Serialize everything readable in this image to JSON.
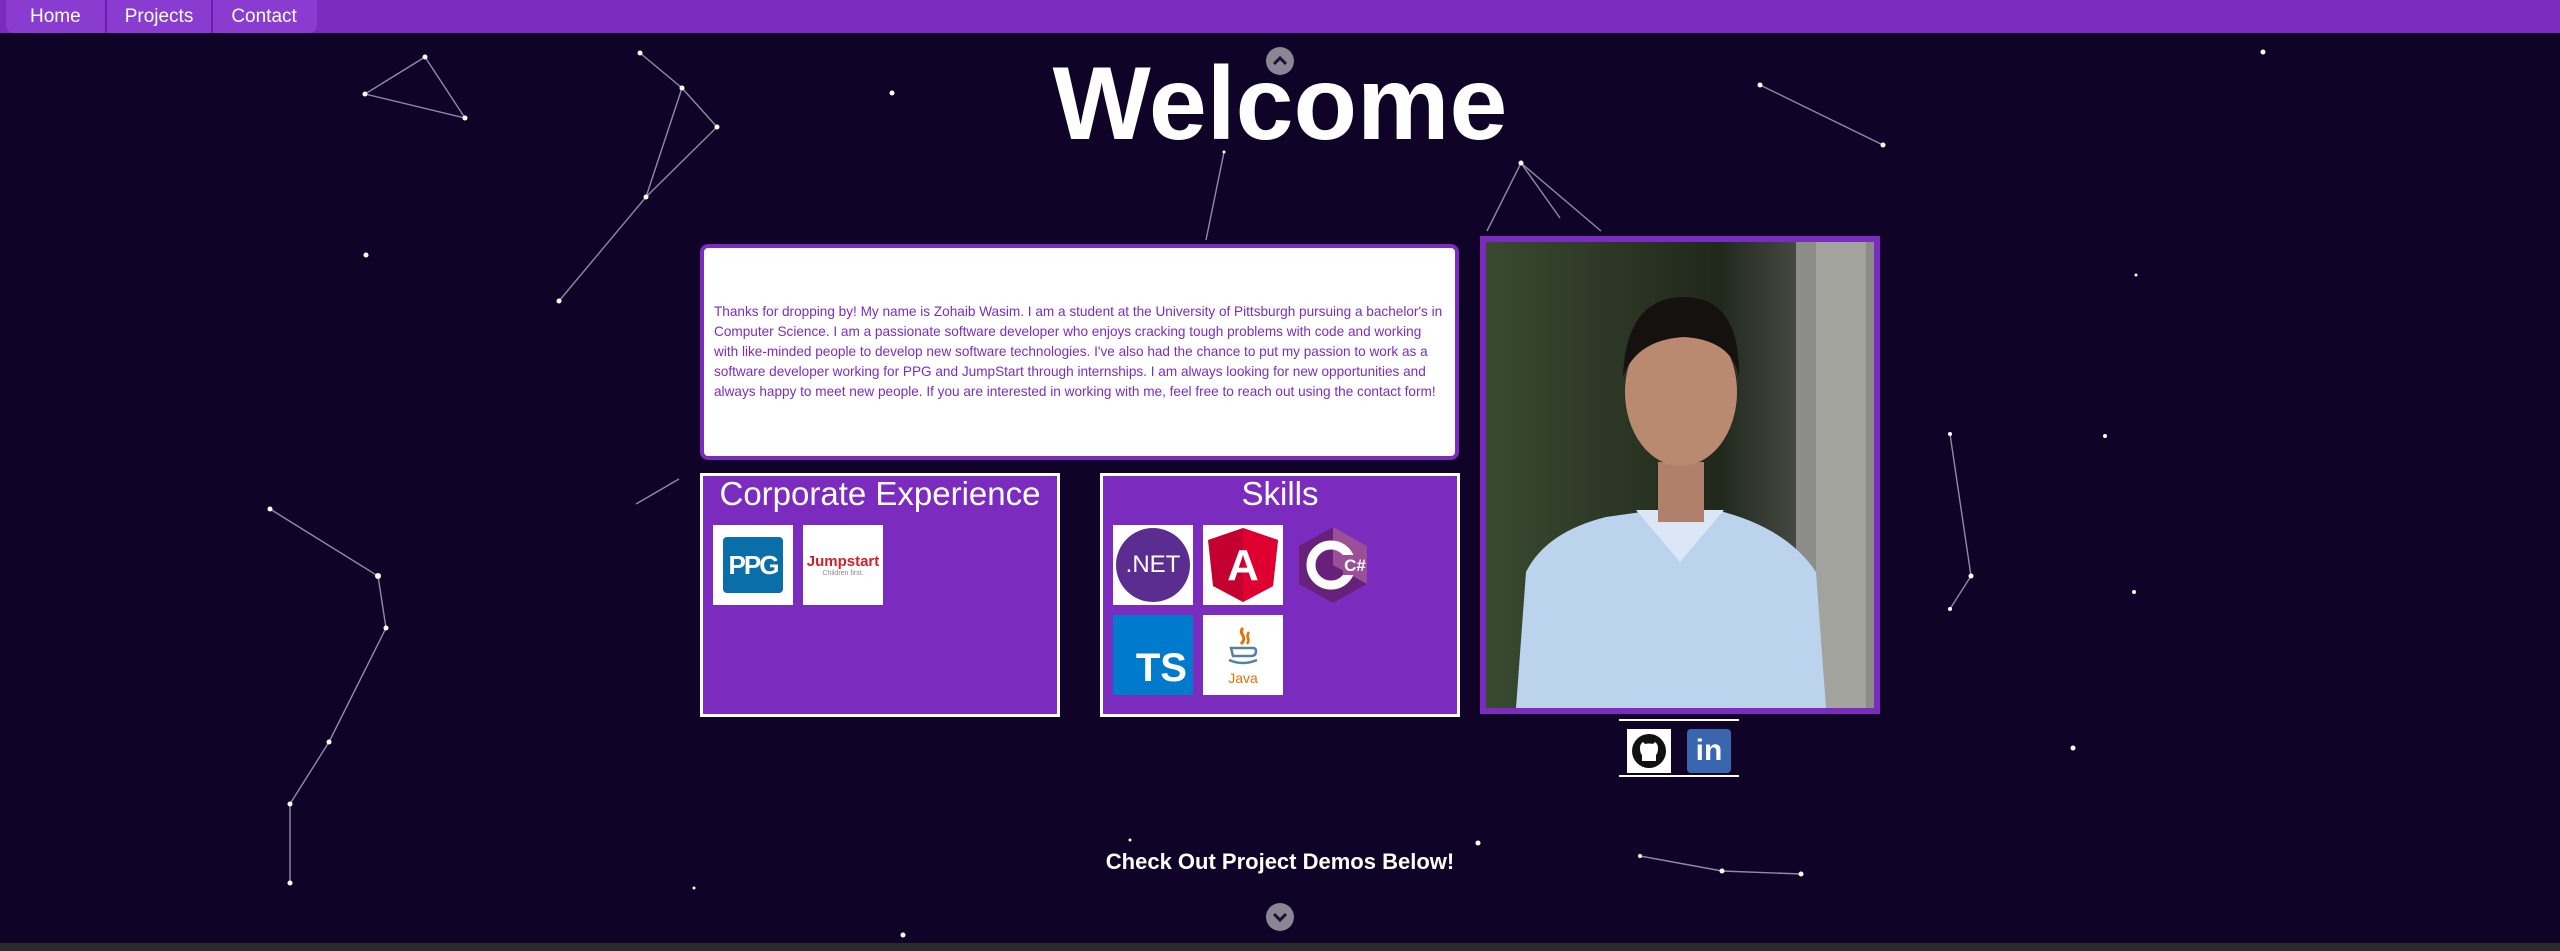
{
  "nav": {
    "items": [
      "Home",
      "Projects",
      "Contact"
    ]
  },
  "hero": {
    "title": "Welcome"
  },
  "about": {
    "text": "Thanks for dropping by! My name is Zohaib Wasim. I am a student at the University of Pittsburgh pursuing a bachelor's in Computer Science. I am a passionate software developer who enjoys cracking tough problems with code and working with like-minded people to develop new software technologies. I've also had the chance to put my passion to work as a software developer working for PPG and JumpStart through internships. I am always looking for new opportunities and always happy to meet new people. If you are interested in working with me, feel free to reach out using the contact form!"
  },
  "corporate": {
    "title": "Corporate Experience",
    "logos": [
      {
        "icon": "ppg-logo",
        "text": "PPG"
      },
      {
        "icon": "jumpstart-logo",
        "text": "Jumpstart",
        "tagline": "Children first."
      }
    ]
  },
  "skills": {
    "title": "Skills",
    "logos": [
      {
        "icon": "dotnet-logo",
        "text": ".NET"
      },
      {
        "icon": "angular-logo",
        "text": "A"
      },
      {
        "icon": "csharp-logo",
        "text": "C#"
      },
      {
        "icon": "typescript-logo",
        "text": "TS"
      },
      {
        "icon": "java-logo",
        "text": "Java"
      }
    ]
  },
  "social": [
    {
      "icon": "github-icon"
    },
    {
      "icon": "linkedin-icon",
      "text": "in"
    }
  ],
  "cta": {
    "text": "Check Out Project Demos Below!"
  },
  "colors": {
    "background": "#0f0328",
    "accent": "#7b2cbf",
    "white": "#ffffff"
  }
}
